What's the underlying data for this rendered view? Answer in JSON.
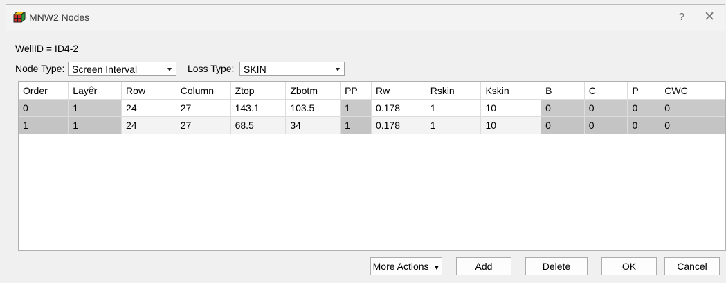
{
  "window": {
    "title": "MNW2 Nodes",
    "help_glyph": "?",
    "close_glyph": "✕"
  },
  "well": {
    "label": "WellID = ID4-2"
  },
  "node_type": {
    "label": "Node Type:",
    "value": "Screen Interval"
  },
  "loss_type": {
    "label": "Loss Type:",
    "value": "SKIN"
  },
  "table": {
    "columns": [
      "Order",
      "Layer",
      "Row",
      "Column",
      "Ztop",
      "Zbotm",
      "PP",
      "Rw",
      "Rskin",
      "Kskin",
      "B",
      "C",
      "P",
      "CWC"
    ],
    "rows": [
      [
        "0",
        "1",
        "24",
        "27",
        "143.1",
        "103.5",
        "1",
        "0.178",
        "1",
        "10",
        "0",
        "0",
        "0",
        "0"
      ],
      [
        "1",
        "1",
        "24",
        "27",
        "68.5",
        "34",
        "1",
        "0.178",
        "1",
        "10",
        "0",
        "0",
        "0",
        "0"
      ]
    ]
  },
  "buttons": {
    "more_actions": "More Actions",
    "add": "Add",
    "delete": "Delete",
    "ok": "OK",
    "cancel": "Cancel"
  }
}
